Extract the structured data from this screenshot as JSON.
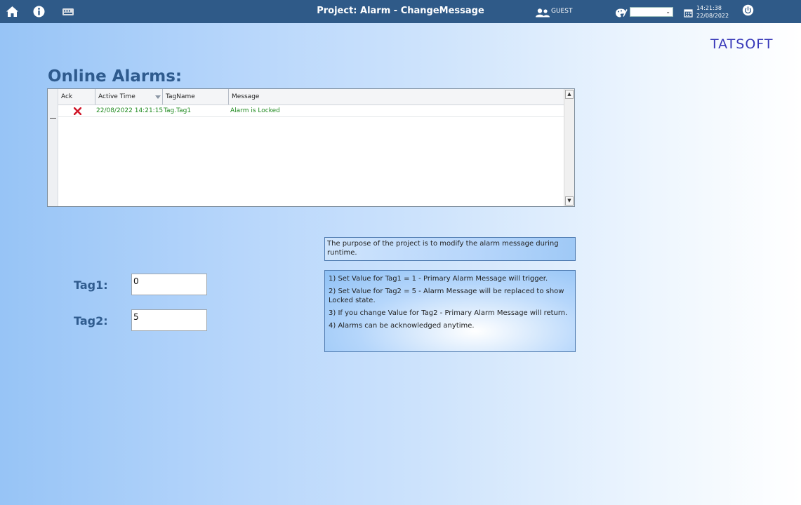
{
  "topbar": {
    "title": "Project: Alarm - ChangeMessage",
    "user_name": "GUEST",
    "theme_value": "",
    "time": "14:21:38",
    "date": "22/08/2022",
    "icons": [
      "home-icon",
      "info-icon",
      "keyboard-icon",
      "users-icon",
      "palette-icon",
      "calendar-icon",
      "power-icon"
    ]
  },
  "logo": {
    "text": "TATSOFT"
  },
  "alarms": {
    "heading": "Online Alarms:",
    "columns": [
      "Ack",
      "Active Time",
      "TagName",
      "Message"
    ],
    "rows": [
      {
        "ack": "X",
        "active_time": "22/08/2022 14:21:15",
        "tag_name": "Tag.Tag1",
        "message": "Alarm is Locked"
      }
    ]
  },
  "tags": {
    "tag1_label": "Tag1:",
    "tag1_value": "0",
    "tag2_label": "Tag2:",
    "tag2_value": "5"
  },
  "info": {
    "purpose": "The purpose of the project is to modify the alarm message during runtime.",
    "steps": [
      "1) Set Value for Tag1 = 1 - Primary Alarm Message will trigger.",
      "2) Set Value for Tag2 = 5 - Alarm Message will be replaced to show Locked state.",
      "3) If you change Value for Tag2 - Primary Alarm Message will return.",
      "4) Alarms can be acknowledged anytime."
    ]
  },
  "colors": {
    "topbar": "#2f5a88",
    "heading": "#2f5b8e",
    "alarm_text": "#1f8a1f",
    "ack_icon": "#d0182a",
    "logo": "#3536b8"
  }
}
